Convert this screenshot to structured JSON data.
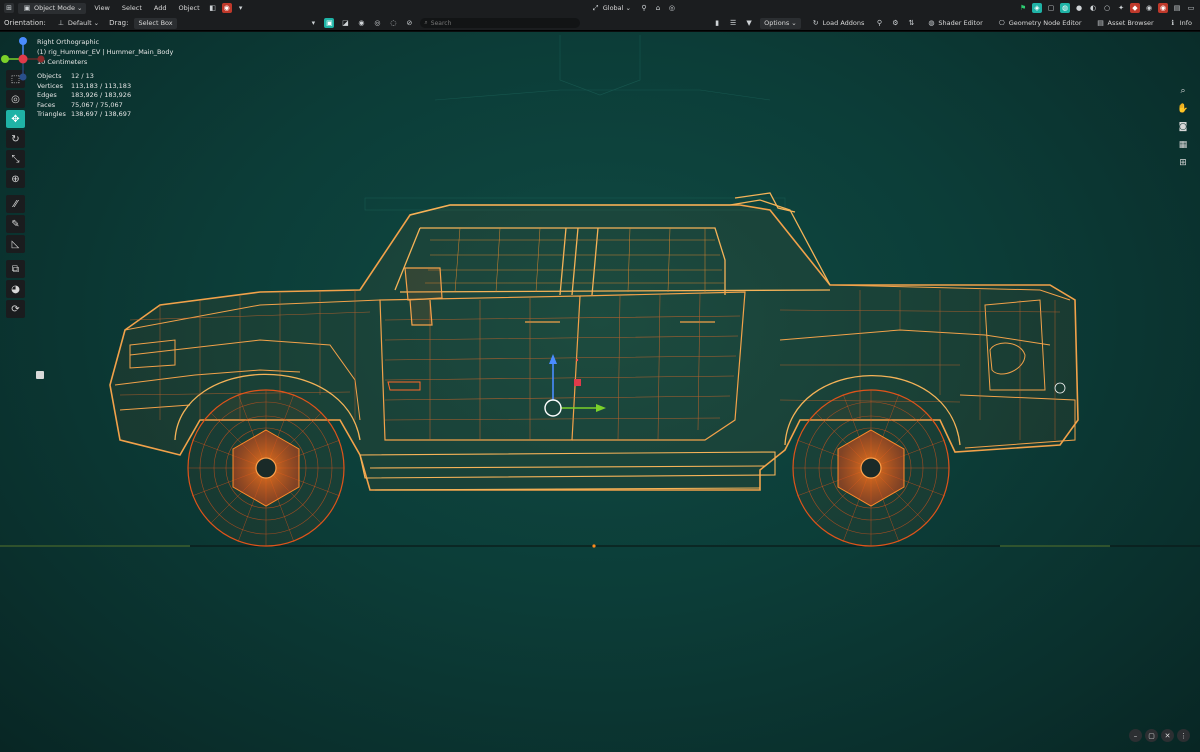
{
  "topbar": {
    "mode": "Object Mode",
    "menu": [
      "View",
      "Select",
      "Add",
      "Object"
    ],
    "transform_orientation": "Global",
    "right_buttons": []
  },
  "subbar": {
    "orientation_label": "Orientation:",
    "orientation_value": "Default",
    "drag_label": "Drag:",
    "drag_value": "Select Box",
    "search_placeholder": "Search",
    "options_label": "Options",
    "load_addons_label": "Load Addons",
    "shader_editor_label": "Shader Editor",
    "geometry_node_editor_label": "Geometry Node Editor",
    "asset_browser_label": "Asset Browser",
    "info_label": "Info"
  },
  "viewport": {
    "view_name": "Right Orthographic",
    "object_path": "(1) rig_Hummer_EV | Hummer_Main_Body",
    "scale": "10 Centimeters",
    "stats": [
      {
        "label": "Objects",
        "value": "12 / 13"
      },
      {
        "label": "Vertices",
        "value": "113,183 / 113,183"
      },
      {
        "label": "Edges",
        "value": "183,926 / 183,926"
      },
      {
        "label": "Faces",
        "value": "75,067 / 75,067"
      },
      {
        "label": "Triangles",
        "value": "138,697 / 138,697"
      }
    ]
  },
  "gizmo_axes": {
    "x": "X",
    "y": "Y",
    "z": "Z"
  },
  "colors": {
    "accent": "#1fb3a6",
    "wire_orange": "#f08a24",
    "wire_deep": "#e0541a",
    "wire_light": "#f2b35a",
    "viewport_bg": "#0c3d38"
  }
}
